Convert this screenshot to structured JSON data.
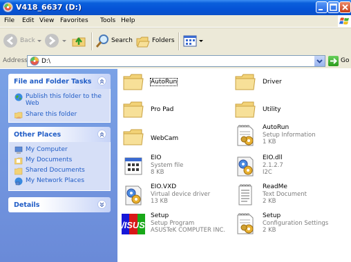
{
  "window": {
    "title": "V418_6637 (D:)"
  },
  "menu": [
    "File",
    "Edit",
    "View",
    "Favorites",
    "Tools",
    "Help"
  ],
  "toolbar": {
    "back": "Back",
    "search": "Search",
    "folders": "Folders"
  },
  "address": {
    "label": "Address",
    "value": "D:\\",
    "go": "Go"
  },
  "tasks": {
    "file_folder": {
      "title": "File and Folder Tasks",
      "items": [
        "Publish this folder to the Web",
        "Share this folder"
      ]
    },
    "other_places": {
      "title": "Other Places",
      "items": [
        "My Computer",
        "My Documents",
        "Shared Documents",
        "My Network Places"
      ]
    },
    "details": {
      "title": "Details"
    }
  },
  "files": [
    {
      "name": "AutoRun",
      "icon": "folder-icon"
    },
    {
      "name": "Driver",
      "icon": "folder-icon"
    },
    {
      "name": "Pro Pad",
      "icon": "folder-icon"
    },
    {
      "name": "Utility",
      "icon": "folder-icon"
    },
    {
      "name": "WebCam",
      "icon": "folder-icon"
    },
    {
      "name": "AutoRun",
      "type": "Setup Information",
      "size": "1 KB",
      "icon": "setup-info-icon"
    },
    {
      "name": "EIO",
      "type": "System file",
      "size": "8 KB",
      "icon": "system-file-icon"
    },
    {
      "name": "EIO.dll",
      "type": "2.1.2.7",
      "size": "I2C",
      "icon": "dll-icon"
    },
    {
      "name": "EIO.VXD",
      "type": "Virtual device driver",
      "size": "13 KB",
      "icon": "vxd-icon"
    },
    {
      "name": "ReadMe",
      "type": "Text Document",
      "size": "2 KB",
      "icon": "text-doc-icon"
    },
    {
      "name": "Setup",
      "type": "Setup Program",
      "size": "ASUSTeK COMPUTER INC.",
      "icon": "asus-setup-icon"
    },
    {
      "name": "Setup",
      "type": "Configuration Settings",
      "size": "2 KB",
      "icon": "config-icon"
    }
  ]
}
